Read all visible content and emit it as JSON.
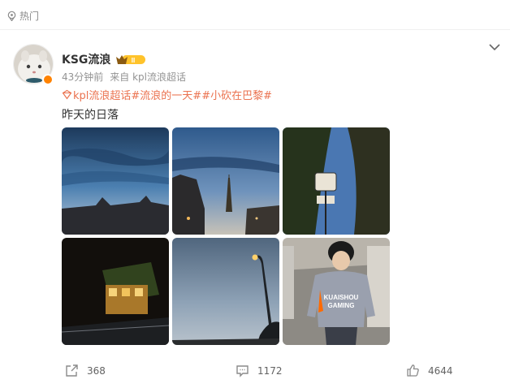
{
  "header": {
    "hot_label": "热门"
  },
  "post": {
    "username": "KSG流浪",
    "vip_level": "II",
    "time": "43分钟前",
    "source": "来自 kpl流浪超话",
    "topics": [
      "kpl流浪超话",
      "#流浪的一天#",
      "#小砍在巴黎#"
    ],
    "text": "昨天的日落",
    "images": [
      {
        "name": "dusk-sky-clouds"
      },
      {
        "name": "eiffel-tower-dusk"
      },
      {
        "name": "street-sign-night"
      },
      {
        "name": "lit-carousel-night"
      },
      {
        "name": "streetlamp-evening-sky"
      },
      {
        "name": "person-jersey-kuaishou"
      }
    ]
  },
  "actions": {
    "share_count": "368",
    "comment_count": "1172",
    "like_count": "4644"
  },
  "colors": {
    "topic": "#eb7350",
    "meta": "#939393",
    "verified": "#ff8200",
    "icon": "#8a8a8a"
  }
}
